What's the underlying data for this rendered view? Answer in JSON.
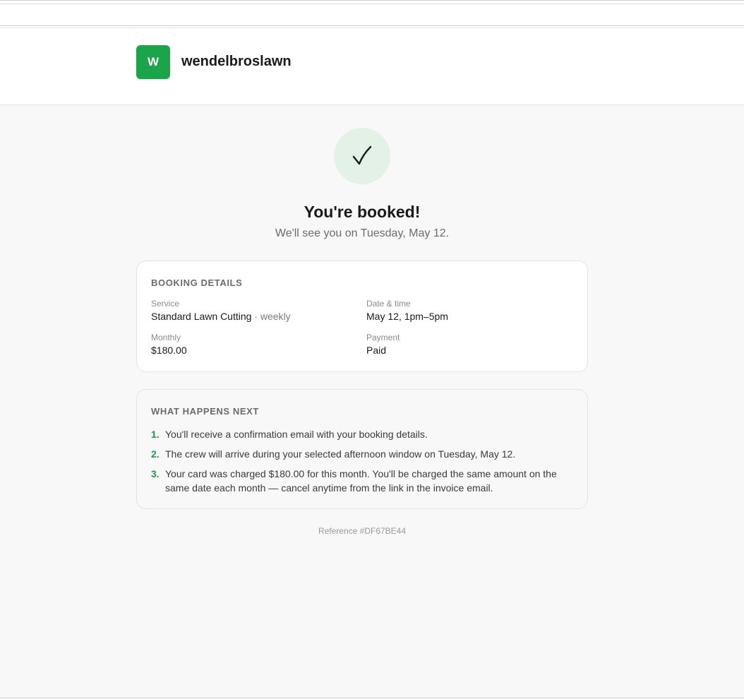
{
  "brand": {
    "initial": "W",
    "name": "wendelbroslawn",
    "color": "#1aa54b"
  },
  "confirmation": {
    "icon": "checkmark-icon",
    "title": "You're booked!",
    "subtitle": "We'll see you on Tuesday, May 12."
  },
  "details": {
    "heading": "BOOKING DETAILS",
    "service_label": "Service",
    "service_value": "Standard Lawn Cutting",
    "service_frequency": " · weekly",
    "datetime_label": "Date & time",
    "datetime_value": "May 12, 1pm–5pm",
    "monthly_label": "Monthly",
    "monthly_value": "$180.00",
    "payment_label": "Payment",
    "payment_value": "Paid"
  },
  "next": {
    "heading": "WHAT HAPPENS NEXT",
    "steps": [
      {
        "num": "1.",
        "text": "You'll receive a confirmation email with your booking details."
      },
      {
        "num": "2.",
        "text": "The crew will arrive during your selected afternoon window on Tuesday, May 12."
      },
      {
        "num": "3.",
        "text": "Your card was charged $180.00 for this month. You'll be charged the same amount on the same date each month — cancel anytime from the link in the invoice email."
      }
    ]
  },
  "reference": "Reference #DF67BE44"
}
